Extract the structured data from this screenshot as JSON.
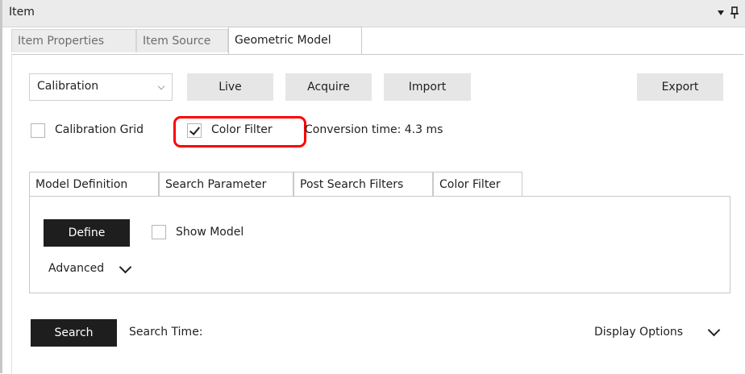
{
  "window": {
    "title": "Item"
  },
  "item_tabs": [
    {
      "label": "Item Properties"
    },
    {
      "label": "Item Source"
    },
    {
      "label": "Geometric Model",
      "active": true
    }
  ],
  "toolbar": {
    "mode_select": {
      "selected": "Calibration"
    },
    "live_label": "Live",
    "acquire_label": "Acquire",
    "import_label": "Import",
    "export_label": "Export"
  },
  "options": {
    "calibration_grid": {
      "label": "Calibration Grid",
      "checked": false
    },
    "color_filter": {
      "label": "Color Filter",
      "checked": true
    },
    "conversion_time": "Conversion time: 4.3 ms"
  },
  "inner_tabs": [
    {
      "label": "Model Definition",
      "active": true
    },
    {
      "label": "Search Parameter"
    },
    {
      "label": "Post Search Filters"
    },
    {
      "label": "Color Filter"
    }
  ],
  "model_definition": {
    "define_label": "Define",
    "show_model": {
      "label": "Show Model",
      "checked": false
    },
    "advanced_label": "Advanced"
  },
  "footer": {
    "search_label": "Search",
    "search_time_label": "Search Time:",
    "display_options_label": "Display Options"
  },
  "colors": {
    "highlight": "#ff0000",
    "dark_button": "#1e1e1e",
    "gray_button": "#e6e6e6"
  }
}
